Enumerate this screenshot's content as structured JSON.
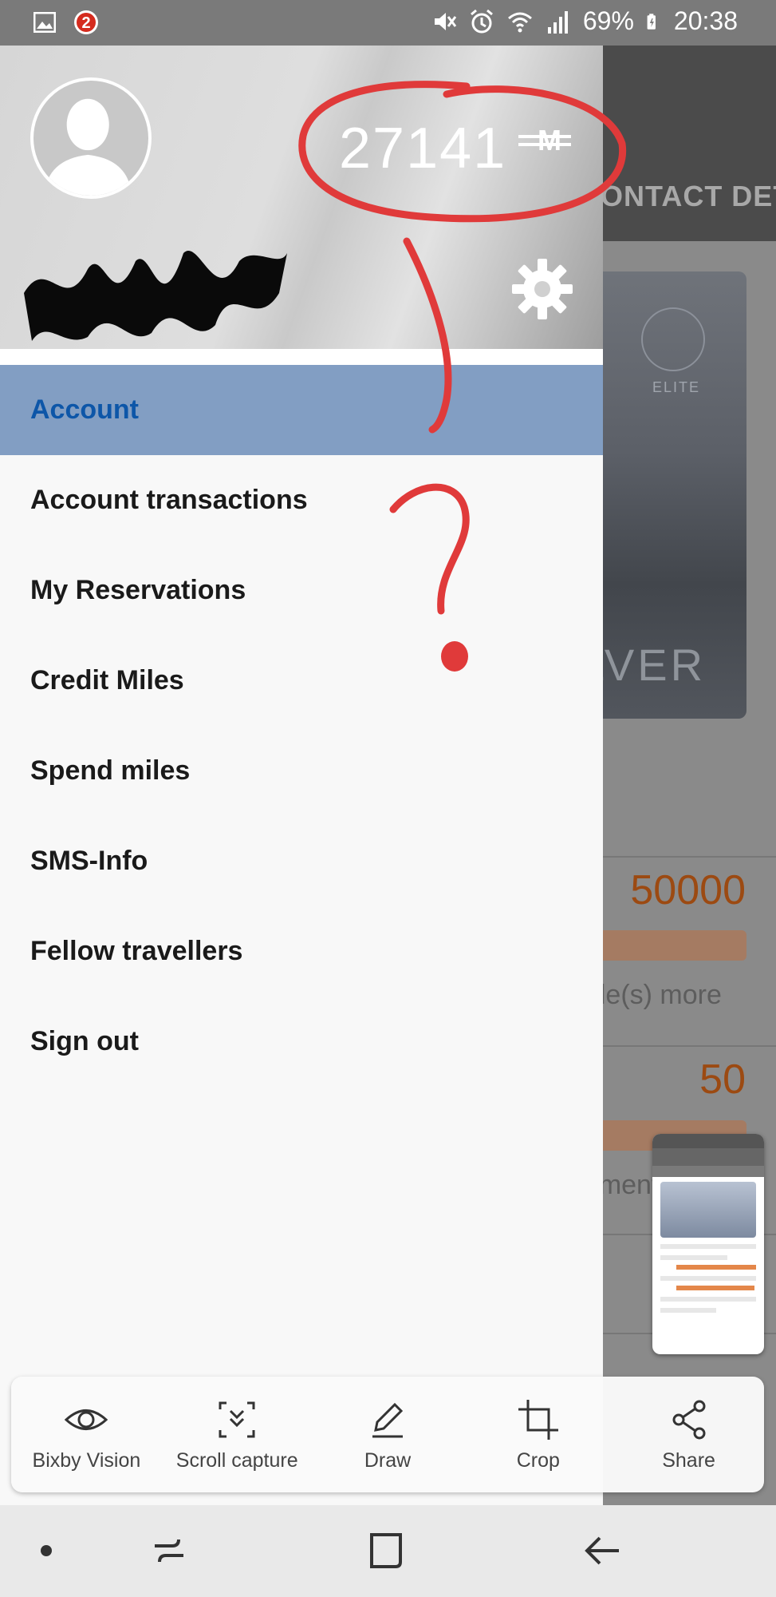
{
  "status_bar": {
    "battery": "69%",
    "time": "20:38",
    "icons": [
      "image-icon",
      "notification-app-icon",
      "mute-icon",
      "alarm-icon",
      "wifi-icon",
      "signal-icon",
      "battery-icon"
    ]
  },
  "drawer": {
    "miles_value": "27141",
    "miles_unit": "M",
    "menu": [
      {
        "label": "Account",
        "active": true
      },
      {
        "label": "Account transactions"
      },
      {
        "label": "My Reservations"
      },
      {
        "label": "Credit Miles"
      },
      {
        "label": "Spend miles"
      },
      {
        "label": "SMS-Info"
      },
      {
        "label": "Fellow travellers"
      },
      {
        "label": "Sign out"
      }
    ]
  },
  "background_app": {
    "header_tab": "CONTACT DETAILS",
    "card_badge": "ELITE",
    "card_tier": "SILVER",
    "value_1": "50000",
    "text_1": "mile(s) more",
    "value_2": "50",
    "text_2": "segment(s)"
  },
  "toolbar": {
    "items": [
      {
        "label": "Bixby Vision",
        "icon": "eye-icon"
      },
      {
        "label": "Scroll capture",
        "icon": "scroll-capture-icon"
      },
      {
        "label": "Draw",
        "icon": "pencil-icon"
      },
      {
        "label": "Crop",
        "icon": "crop-icon"
      },
      {
        "label": "Share",
        "icon": "share-icon"
      }
    ]
  },
  "annotation": {
    "question_mark": "?"
  },
  "colors": {
    "active_item_bg": "#829ec3",
    "active_item_text": "#0d56a8",
    "annotation_red": "#e03a3a",
    "accent_orange": "#9c4a12"
  }
}
